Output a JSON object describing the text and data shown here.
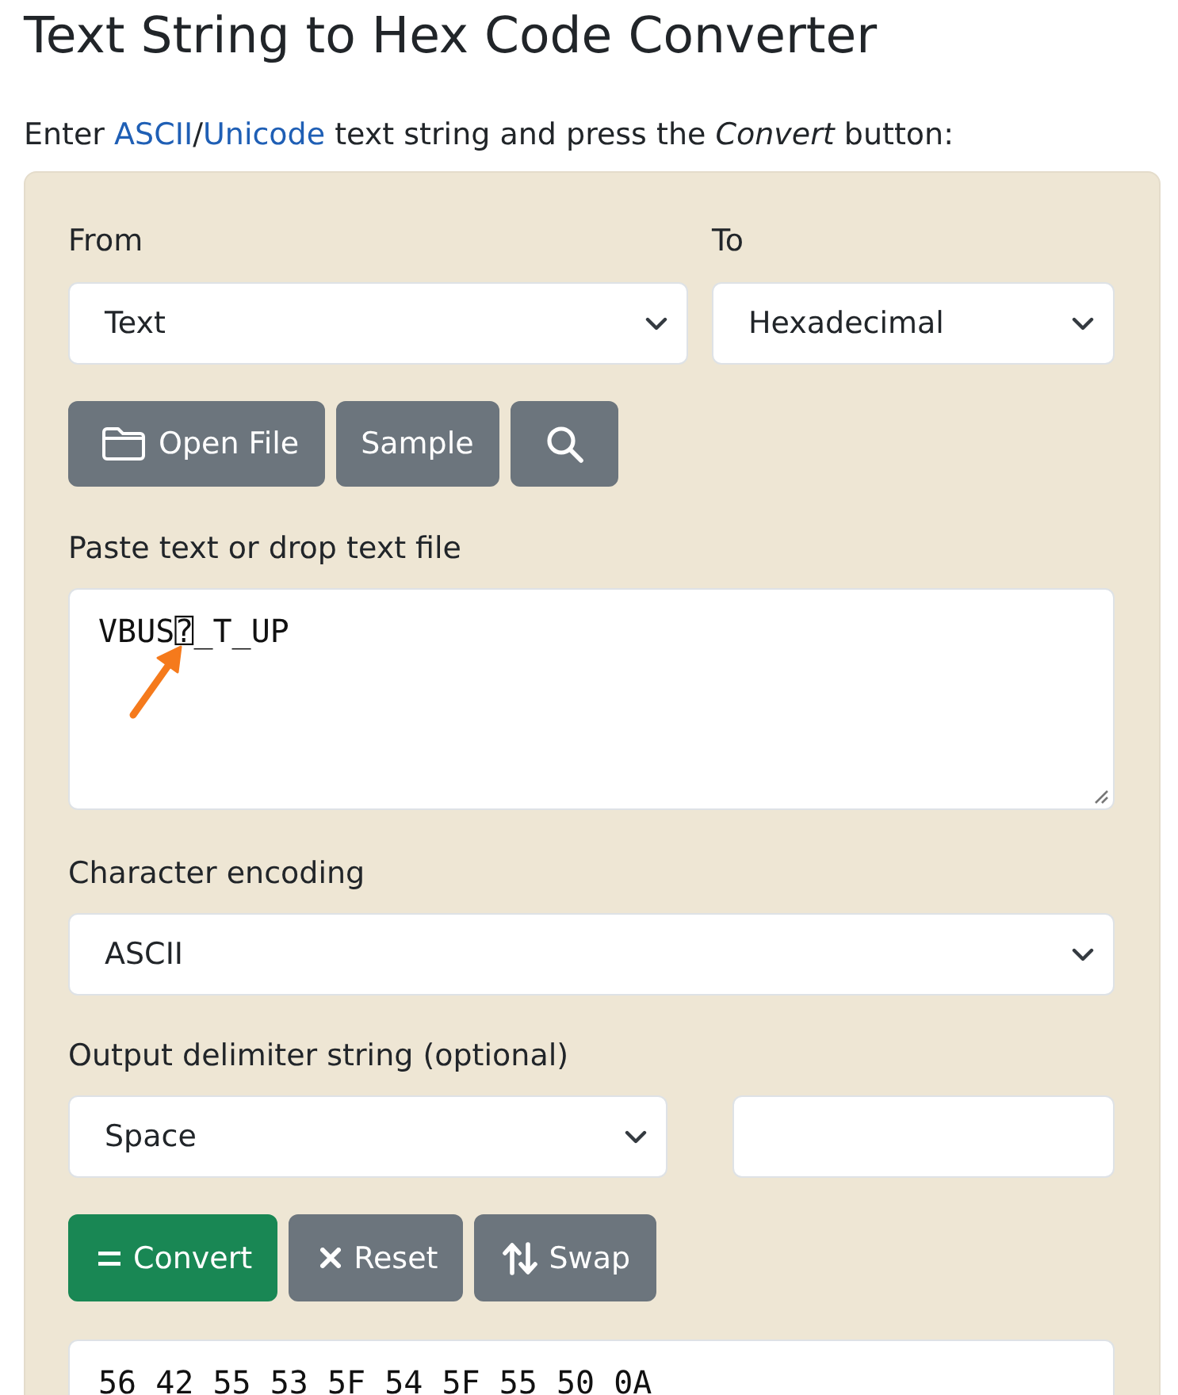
{
  "title": "Text String to Hex Code Converter",
  "intro": [
    {
      "kind": "text",
      "text": "Enter "
    },
    {
      "kind": "link",
      "text": "ASCII"
    },
    {
      "kind": "text",
      "text": "/"
    },
    {
      "kind": "link",
      "text": "Unicode"
    },
    {
      "kind": "text",
      "text": " text string and press the *Convert* button:"
    }
  ],
  "converter": {
    "from": {
      "label": "From",
      "value": "Text"
    },
    "to": {
      "label": "To",
      "value": "Hexadecimal"
    },
    "file_buttons": [
      {
        "kind": "open",
        "label": "Open File"
      },
      {
        "kind": "sample",
        "label": "Sample"
      },
      {
        "kind": "search"
      }
    ],
    "input": {
      "label": "Paste text or drop text file",
      "value": "VBUS⍰_T_UP"
    },
    "encoding": {
      "label": "Character encoding",
      "value": "ASCII"
    },
    "delimiter": {
      "label": "Output delimiter string (optional)",
      "value": "Space"
    },
    "action_buttons": [
      {
        "kind": "convert",
        "label": "Convert"
      },
      {
        "kind": "reset",
        "label": "Reset"
      },
      {
        "kind": "swap",
        "label": "Swap"
      }
    ],
    "output": {
      "value": "56 42 55 53 5F 54 5F 55 50 0A"
    }
  }
}
